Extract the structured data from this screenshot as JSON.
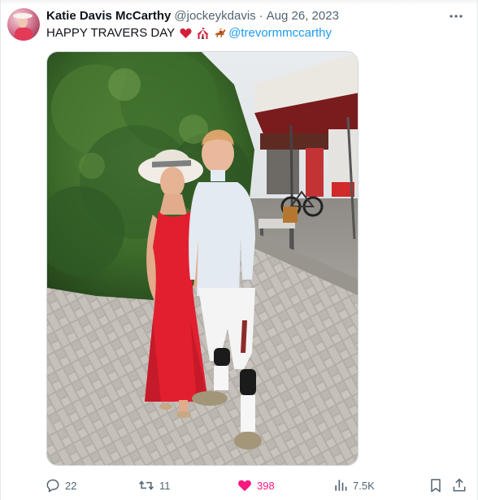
{
  "tweet": {
    "author_name": "Katie Davis McCarthy",
    "handle": "@jockeykdavis",
    "separator": "·",
    "date": "Aug 26, 2023",
    "text": "HAPPY TRAVERS DAY",
    "mention": "@trevormmccarthy",
    "emojis": [
      "red-heart-icon",
      "circus-tent-icon",
      "horse-racing-icon"
    ]
  },
  "actions": {
    "replies": "22",
    "reposts": "11",
    "likes": "398",
    "views": "7.5K"
  },
  "colors": {
    "text": "#0f1419",
    "secondary": "#536471",
    "link": "#1d9bf0",
    "like": "#f91880",
    "border": "#cfd9de"
  }
}
